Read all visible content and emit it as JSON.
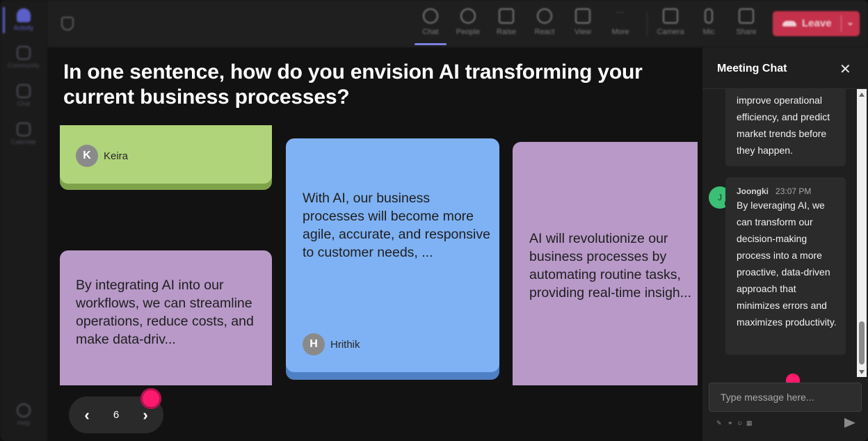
{
  "rail": {
    "items": [
      {
        "label": "Activity",
        "active": true
      },
      {
        "label": "Community"
      },
      {
        "label": "Chat"
      },
      {
        "label": "Calendar"
      },
      {
        "label": "Help"
      }
    ]
  },
  "toolbar": {
    "buttons": [
      {
        "label": "Chat",
        "icon": "chat-icon",
        "active": true
      },
      {
        "label": "People",
        "icon": "people-icon"
      },
      {
        "label": "Raise",
        "icon": "raise-hand-icon"
      },
      {
        "label": "React",
        "icon": "react-icon"
      },
      {
        "label": "View",
        "icon": "view-grid-icon"
      },
      {
        "label": "More",
        "icon": "more-icon"
      },
      {
        "label": "Camera",
        "icon": "camera-off-icon"
      },
      {
        "label": "Mic",
        "icon": "mic-icon"
      },
      {
        "label": "Share",
        "icon": "share-icon"
      }
    ],
    "leave_label": "Leave",
    "leave_color": "#c4314b"
  },
  "board": {
    "question": "In one sentence, how do you envision AI transforming your current business processes?",
    "cards": [
      {
        "author": "Keira",
        "initial": "K",
        "color": "#b0d47a"
      },
      {
        "text": "By integrating AI into our workflows, we can streamline operations, reduce costs, and make data-driv...",
        "color": "#b899c8"
      },
      {
        "text": "With AI, our business processes will become more agile, accurate, and responsive to customer needs, ...",
        "author": "Hrithik",
        "initial": "H",
        "color": "#7fb2f4"
      },
      {
        "text": "AI will revolutionize our business processes by automating routine tasks, providing real-time insigh...",
        "color": "#b899c8"
      }
    ],
    "pager": {
      "page": "6"
    }
  },
  "chat": {
    "title": "Meeting Chat",
    "messages": [
      {
        "text": "improve operational efficiency, and predict market trends before they happen."
      },
      {
        "sender": "Joongki",
        "initial": "J",
        "time": "23:07 PM",
        "text": "By leveraging AI, we can transform our decision-making process into a more proactive, data-driven approach that minimizes errors and maximizes productivity."
      }
    ],
    "input_placeholder": "Type message here..."
  }
}
